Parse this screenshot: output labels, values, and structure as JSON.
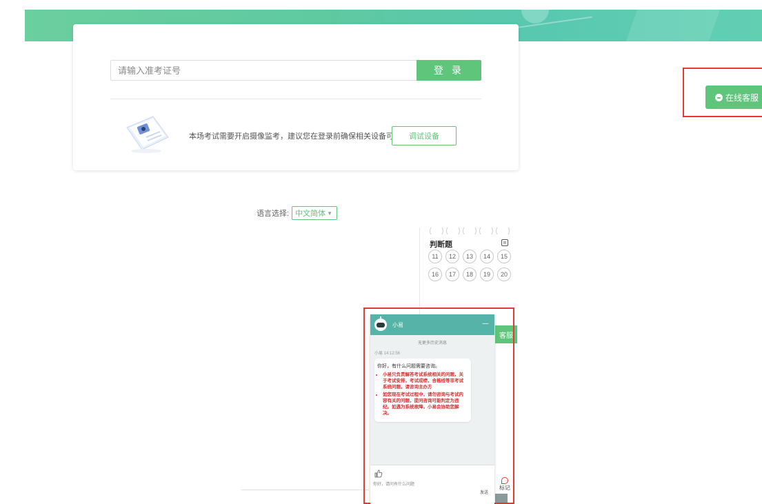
{
  "login": {
    "placeholder": "请输入准考证号",
    "login_label": "登 录",
    "camera_notice": "本场考试需要开启摄像监考，建议您在登录前确保相关设备可用。",
    "test_device_label": "调试设备"
  },
  "language": {
    "label": "语言选择:",
    "selected": "中文简体"
  },
  "customer_service": {
    "label": "在线客服"
  },
  "question_panel": {
    "section_title": "判断题",
    "numbers": [
      "11",
      "12",
      "13",
      "14",
      "15",
      "16",
      "17",
      "18",
      "19",
      "20"
    ],
    "tab_label": "客服",
    "mark_label": "标记"
  },
  "chat": {
    "bot_name": "小易",
    "minimize": "—",
    "load_more": "无更多历史消息",
    "meta": "小易  14:12:56",
    "greeting": "你好，有什么问题需要咨询。",
    "notices": [
      "小易只负责解答考试系统相关的问题，关于考试安排，考试成绩，合格线等非考试系统问题，请咨询主办方",
      "如您现在考试过程中，请勿咨询与考试内容有关的问题，提问咨询可能判定为违纪。如遇为系统故障，小易会协助您解决。"
    ],
    "input_placeholder": "你好，请问有什么问题",
    "send_label": "发送"
  }
}
